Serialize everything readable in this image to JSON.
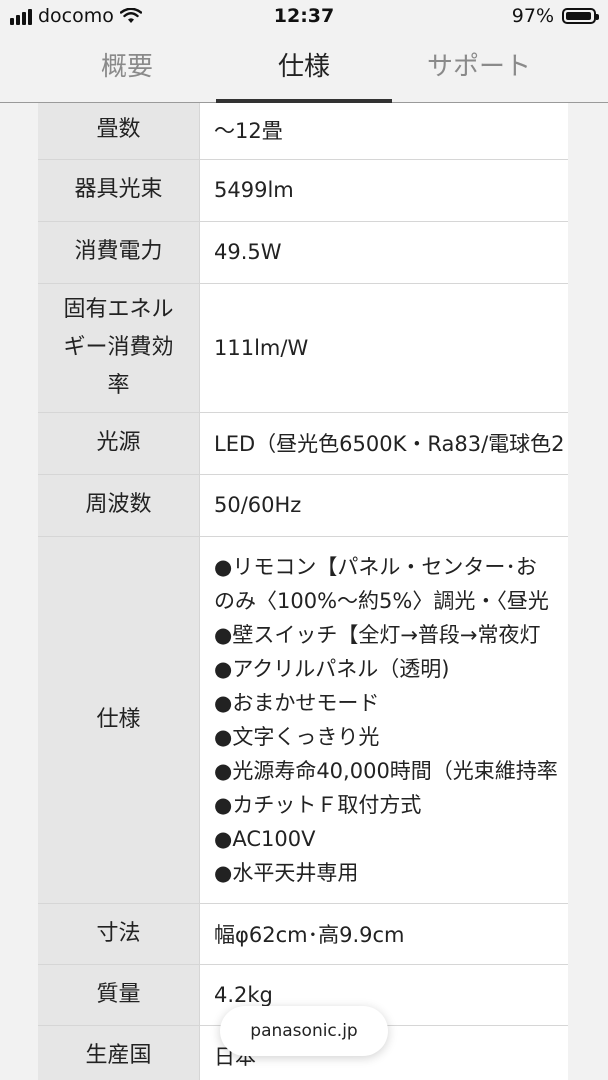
{
  "status_bar": {
    "carrier": "docomo",
    "time": "12:37",
    "battery": "97%"
  },
  "tabs": [
    {
      "label": "概要"
    },
    {
      "label": "仕様"
    },
    {
      "label": "サポート"
    }
  ],
  "specs": {
    "tatami": {
      "key": "畳数",
      "value": "～12畳"
    },
    "flux": {
      "key": "器具光束",
      "value": "5499lm"
    },
    "power": {
      "key": "消費電力",
      "value": "49.5W"
    },
    "efficiency": {
      "key_lines": [
        "固有エネル",
        "ギー消費効",
        "率"
      ],
      "value": "111lm/W"
    },
    "light_source": {
      "key": "光源",
      "value": "LED（昼光色6500K・Ra83/電球色2"
    },
    "frequency": {
      "key": "周波数",
      "value": "50/60Hz"
    },
    "specification": {
      "key": "仕様",
      "lines": [
        "●リモコン【パネル・センター･お",
        "のみ〈100%～約5%〉調光・〈昼光",
        "●壁スイッチ【全灯→普段→常夜灯",
        "●アクリルパネル（透明)",
        "●おまかせモード",
        "●文字くっきり光",
        "●光源寿命40,000時間（光束維持率",
        "●カチットＦ取付方式",
        "●AC100V",
        "●水平天井専用"
      ]
    },
    "dimensions": {
      "key": "寸法",
      "value": "幅φ62cm･高9.9cm"
    },
    "weight": {
      "key": "質量",
      "value": "4.2kg"
    },
    "origin": {
      "key": "生産国",
      "value": "日本"
    }
  },
  "domain_pill": "panasonic.jp"
}
